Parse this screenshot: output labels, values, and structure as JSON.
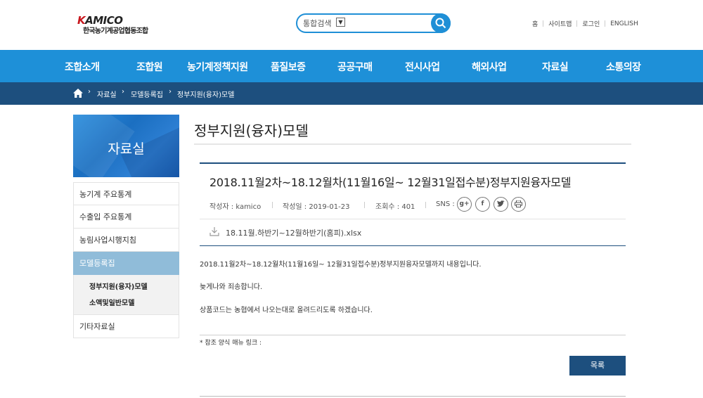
{
  "header": {
    "logo_mark": "KAMICO",
    "logo_name": "한국농기계공업협동조합",
    "search": {
      "select_label": "통합검색",
      "placeholder": ""
    },
    "util_links": [
      "홈",
      "사이트맵",
      "로그인",
      "ENGLISH"
    ]
  },
  "gnb": [
    "조합소개",
    "조합원",
    "농기계정책지원",
    "품질보증",
    "공공구매",
    "전시사업",
    "해외사업",
    "자료실",
    "소통의장"
  ],
  "breadcrumb": [
    "자료실",
    "모델등록집",
    "정부지원(융자)모델"
  ],
  "sidebar": {
    "title": "자료실",
    "items": [
      "농기계 주요통계",
      "수출입 주요통계",
      "농림사업시행지침",
      "모델등록집",
      "기타자료실"
    ],
    "sub_items": [
      "정부지원(융자)모델",
      "소액및일반모델"
    ]
  },
  "content": {
    "page_title": "정부지원(융자)모델",
    "post": {
      "title": "2018.11월2차~18.12월차(11월16일~ 12월31일접수분)정부지원융자모델",
      "author": "작성자 : kamico",
      "date": "작성일 : 2019-01-23",
      "views": "조회수 : 401",
      "sns_label": "SNS :",
      "sns_icons": [
        "google-plus-icon",
        "facebook-icon",
        "twitter-icon",
        "print-icon"
      ],
      "file": "18.11월.하반기~12월하반기(홈피).xlsx",
      "body": [
        "2018.11월2차~18.12월차(11월16일~ 12월31일접수분)정부지원융자모델까지 내용입니다.",
        "늦게나와 죄송합니다.",
        "상품코드는 농협에서 나오는대로 올려드리도록 하겠습니다."
      ],
      "reference": "* 참조 양식 매뉴 링크 :"
    },
    "list_button": "목록"
  },
  "colors": {
    "gnb": "#1e90d8",
    "breadcrumb": "#1d4f7e",
    "sidebar_active": "#90bcd9",
    "logo_accent": "#c8161d"
  }
}
